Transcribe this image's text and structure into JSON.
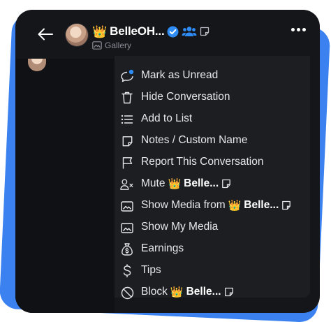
{
  "colors": {
    "accent_blue": "#3b82f0",
    "card_bg": "#15161a",
    "menu_bg": "#1d1e22",
    "text": "#e6e7ea",
    "muted": "#8b8e98",
    "verified": "#2f8cf5"
  },
  "header": {
    "crown_emoji": "👑",
    "display_name": "BelleOH...",
    "gallery_label": "Gallery"
  },
  "menu": {
    "items": [
      {
        "icon": "chat-bubble-unread-icon",
        "label": "Mark as Unread"
      },
      {
        "icon": "trash-icon",
        "label": "Hide Conversation"
      },
      {
        "icon": "list-icon",
        "label": "Add to List"
      },
      {
        "icon": "note-icon",
        "label": "Notes / Custom Name"
      },
      {
        "icon": "flag-icon",
        "label": "Report This Conversation"
      },
      {
        "icon": "mute-user-icon",
        "label": "Mute",
        "crown": "👑",
        "name": "Belle..."
      },
      {
        "icon": "image-icon",
        "label": "Show Media from",
        "crown": "👑",
        "name": "Belle..."
      },
      {
        "icon": "image-icon",
        "label": "Show My Media"
      },
      {
        "icon": "money-bag-icon",
        "label": "Earnings"
      },
      {
        "icon": "dollar-icon",
        "label": "Tips"
      },
      {
        "icon": "block-icon",
        "label": "Block",
        "crown": "👑",
        "name": "Belle..."
      }
    ]
  }
}
